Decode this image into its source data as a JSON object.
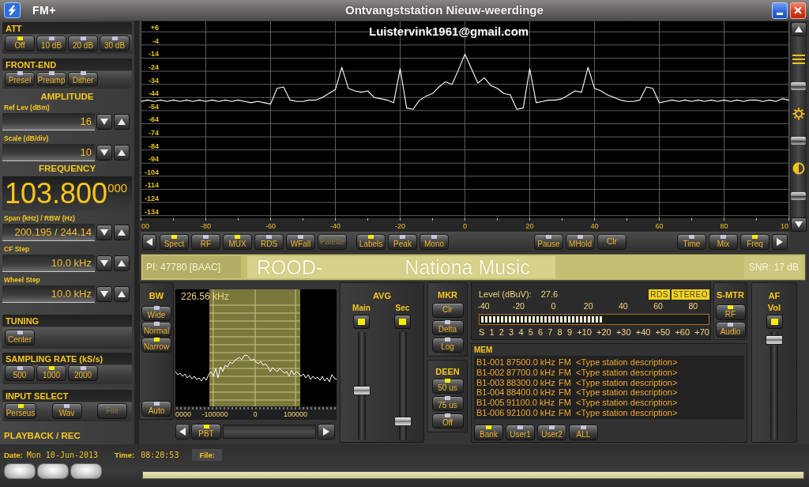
{
  "window": {
    "title": "FM+",
    "caption": "Ontvangststation Nieuw-weerdinge",
    "email": "Luistervink1961@gmail.com"
  },
  "left_panel": {
    "att": {
      "title": "ATT",
      "buttons": [
        {
          "label": "Off",
          "on": true
        },
        {
          "label": "10 dB",
          "on": false
        },
        {
          "label": "20 dB",
          "on": false
        },
        {
          "label": "30 dB",
          "on": false
        }
      ]
    },
    "front_end": {
      "title": "FRONT-END",
      "buttons": [
        {
          "label": "Presel",
          "on": false
        },
        {
          "label": "Preamp",
          "on": false
        },
        {
          "label": "Dither",
          "on": false
        }
      ]
    },
    "amplitude": {
      "title": "AMPLITUDE",
      "fields": [
        {
          "label": "Ref Lev (dBm)",
          "value": "16"
        },
        {
          "label": "Scale (dB/div)",
          "value": "10"
        }
      ]
    },
    "frequency": {
      "title": "FREQUENCY",
      "display": "103.800$^{000}$",
      "fields": [
        {
          "label": "Span (kHz) / RBW (Hz)",
          "value": "200.195 / 244.14"
        },
        {
          "label": "CF Step",
          "value": "10.0 kHz"
        },
        {
          "label": "Wheel Step",
          "value": "10.0 kHz"
        }
      ]
    },
    "tuning": {
      "title": "TUNING",
      "buttons": [
        {
          "label": "Center",
          "on": false
        }
      ]
    },
    "sampling_rate": {
      "title": "SAMPLING RATE (kS/s)",
      "buttons": [
        {
          "label": "500",
          "on": false
        },
        {
          "label": "1000",
          "on": true
        },
        {
          "label": "2000",
          "on": false
        }
      ]
    },
    "input_select": {
      "title": "INPUT SELECT",
      "buttons": [
        {
          "label": "Perseus",
          "kind": "toggle",
          "on": true,
          "disabled": false
        },
        {
          "label": "Wav",
          "kind": "toggle",
          "on": false,
          "disabled": false
        },
        {
          "label": "File",
          "kind": "action",
          "disabled": true
        }
      ]
    }
  },
  "spectrum": {
    "chart_data": {
      "type": "line",
      "grid": true,
      "xlim": [
        -100,
        100
      ],
      "ylim": [
        -136,
        14
      ],
      "xticks": [
        -80,
        -60,
        -40,
        -20,
        0,
        20,
        40,
        60,
        80
      ],
      "yticks": [
        {
          "value": 6,
          "label": "+6"
        },
        -4,
        -14,
        -24,
        -34,
        -44,
        -54,
        -64,
        -74,
        -84,
        -94,
        -104,
        -114,
        -124,
        -134
      ],
      "x": [
        -100,
        -98,
        -96,
        -94,
        -92,
        -90,
        -88,
        -86,
        -84,
        -82,
        -80,
        -78,
        -76,
        -74,
        -72,
        -70,
        -68,
        -66,
        -64,
        -62,
        -60,
        -58,
        -56,
        -54,
        -52,
        -50,
        -48,
        -46,
        -44,
        -42,
        -40,
        -38,
        -36,
        -34,
        -32,
        -30,
        -28,
        -26,
        -24,
        -22,
        -20,
        -18,
        -16,
        -14,
        -12,
        -10,
        -8,
        -6,
        -4,
        -2,
        0,
        2,
        4,
        6,
        8,
        10,
        12,
        14,
        16,
        18,
        20,
        22,
        24,
        26,
        28,
        30,
        32,
        34,
        36,
        38,
        40,
        42,
        44,
        46,
        48,
        50,
        52,
        54,
        56,
        58,
        60,
        62,
        64,
        66,
        68,
        70,
        72,
        74,
        76,
        78,
        80,
        82,
        84,
        86,
        88,
        90,
        92,
        94,
        96,
        98,
        100
      ],
      "series": [
        {
          "color": "#ffffff",
          "values": [
            -47,
            -46,
            -47,
            -46,
            -47,
            -46,
            -47,
            -46,
            -47,
            -46,
            -47,
            -46,
            -47,
            -46,
            -47,
            -46,
            -47,
            -48,
            -47,
            -48,
            -49,
            -37,
            -36,
            -46,
            -47,
            -47,
            -46,
            -46,
            -44,
            -41,
            -38,
            -21,
            -37,
            -39,
            -40,
            -39,
            -44,
            -45,
            -46,
            -48,
            -22,
            -52,
            -53,
            -46,
            -43,
            -41,
            -36,
            -32,
            -34,
            -23,
            -11,
            -22,
            -33,
            -29,
            -35,
            -37,
            -41,
            -42,
            -53,
            -52,
            -22,
            -48,
            -47,
            -46,
            -46,
            -45,
            -42,
            -39,
            -40,
            -21,
            -37,
            -39,
            -42,
            -44,
            -46,
            -47,
            -47,
            -46,
            -36,
            -37,
            -48,
            -47,
            -46,
            -47,
            -46,
            -47,
            -46,
            -47,
            -46,
            -47,
            -46,
            -47,
            -46,
            -47,
            -46,
            -46,
            -47,
            -46,
            -47,
            -45,
            -46
          ]
        }
      ]
    },
    "edge_labels": [
      "00",
      "10"
    ]
  },
  "spectrum_toolbar": {
    "groups": [
      [
        {
          "label": "Spect",
          "kind": "toggle",
          "on": true,
          "disabled": false
        },
        {
          "label": "RF",
          "kind": "toggle",
          "on": false,
          "disabled": false
        },
        {
          "label": "MUX",
          "kind": "toggle",
          "on": true,
          "disabled": false
        },
        {
          "label": "RDS",
          "kind": "toggle",
          "on": false,
          "disabled": false
        },
        {
          "label": "WFall",
          "kind": "toggle",
          "on": false,
          "disabled": false
        },
        {
          "label": "Palette",
          "kind": "action",
          "disabled": true
        }
      ],
      [
        {
          "label": "Labels",
          "kind": "toggle",
          "on": true,
          "disabled": false
        },
        {
          "label": "Peak",
          "kind": "toggle",
          "on": false,
          "disabled": false
        },
        {
          "label": "Mono",
          "kind": "toggle",
          "on": false,
          "disabled": false
        }
      ],
      [
        {
          "label": "Pause",
          "kind": "toggle",
          "on": false,
          "disabled": false
        },
        {
          "label": "MHold",
          "kind": "toggle",
          "on": false,
          "disabled": false
        },
        {
          "label": "Clr",
          "kind": "action",
          "disabled": false
        }
      ],
      [
        {
          "label": "Time",
          "kind": "toggle",
          "on": false,
          "disabled": false
        },
        {
          "label": "Mix",
          "kind": "toggle",
          "on": false,
          "disabled": false
        },
        {
          "label": "Freq",
          "kind": "toggle",
          "on": true,
          "disabled": false
        }
      ]
    ]
  },
  "rds": {
    "pi": "PI: 47780 [BAAC]",
    "ps": "ROOD-",
    "radiotext": "Nationa Music",
    "snr": "SNR: 17 dB"
  },
  "bandwidth": {
    "title": "BW",
    "buttons": [
      {
        "label": "Wide",
        "on": false
      },
      {
        "label": "Normal",
        "on": false
      },
      {
        "label": "Narrow",
        "on": true
      }
    ],
    "auto": {
      "label": "Auto",
      "on": false
    },
    "readout": "226.56 kHz",
    "axis_labels": [
      "0000",
      "-100000",
      "0",
      "100000"
    ],
    "pbt": {
      "label": "PBT",
      "on": true
    }
  },
  "averaging": {
    "title": "AVG",
    "channels": [
      {
        "label": "Main",
        "on": true,
        "level": 0.45
      },
      {
        "label": "Sec",
        "on": true,
        "level": 0.14
      }
    ]
  },
  "marker": {
    "title": "MKR",
    "buttons": [
      {
        "label": "Clr",
        "kind": "action"
      },
      {
        "label": "Delta",
        "kind": "toggle",
        "on": false
      },
      {
        "label": "Log",
        "kind": "toggle",
        "on": false
      }
    ]
  },
  "deemphasis": {
    "title": "DEEN",
    "buttons": [
      {
        "label": "50 us",
        "on": true
      },
      {
        "label": "75 us",
        "on": false
      },
      {
        "label": "Off",
        "on": false
      }
    ]
  },
  "level_meter": {
    "label": "Level (dBuV):",
    "reading": "27.6",
    "badges": [
      {
        "label": "RDS",
        "on": true
      },
      {
        "label": "STEREO",
        "on": true
      }
    ],
    "scale": [
      "-40",
      "-20",
      "0",
      "20",
      "40",
      "60",
      "80"
    ],
    "level": 0.54,
    "s_units": [
      "S",
      "1",
      "2",
      "3",
      "4",
      "5",
      "6",
      "7",
      "8",
      "9",
      "+10",
      "+20",
      "+30",
      "+40",
      "+50",
      "+60",
      "+70"
    ]
  },
  "s_meter": {
    "title": "S-MTR",
    "buttons": [
      {
        "label": "RF",
        "on": true
      },
      {
        "label": "Audio",
        "on": false
      }
    ]
  },
  "memory": {
    "title": "MEM",
    "rows": [
      {
        "channel": "B1-001",
        "frequency": "87500.0 kHz",
        "mode": "FM",
        "description": "<Type station description>"
      },
      {
        "channel": "B1-002",
        "frequency": "87700.0 kHz",
        "mode": "FM",
        "description": "<Type station description>"
      },
      {
        "channel": "B1-003",
        "frequency": "88300.0 kHz",
        "mode": "FM",
        "description": "<Type station description>"
      },
      {
        "channel": "B1-004",
        "frequency": "88400.0 kHz",
        "mode": "FM",
        "description": "<Type station description>"
      },
      {
        "channel": "B1-005",
        "frequency": "91100.0 kHz",
        "mode": "FM",
        "description": "<Type station description>"
      },
      {
        "channel": "B1-006",
        "frequency": "92100.0 kHz",
        "mode": "FM",
        "description": "<Type station description>"
      }
    ],
    "buttons": [
      {
        "label": "Bank",
        "on": true
      },
      {
        "label": "User1",
        "on": false
      },
      {
        "label": "User2",
        "on": false
      },
      {
        "label": "ALL",
        "on": false
      }
    ]
  },
  "af": {
    "title": "AF",
    "label": "Vol",
    "on": true,
    "level": 0.97
  },
  "status_bar": {
    "title": "PLAYBACK / REC",
    "date_label": "Date:",
    "date": "Mon 10-Jun-2013",
    "time_label": "Time:",
    "time": "08:20:53",
    "file_label": "File:"
  }
}
